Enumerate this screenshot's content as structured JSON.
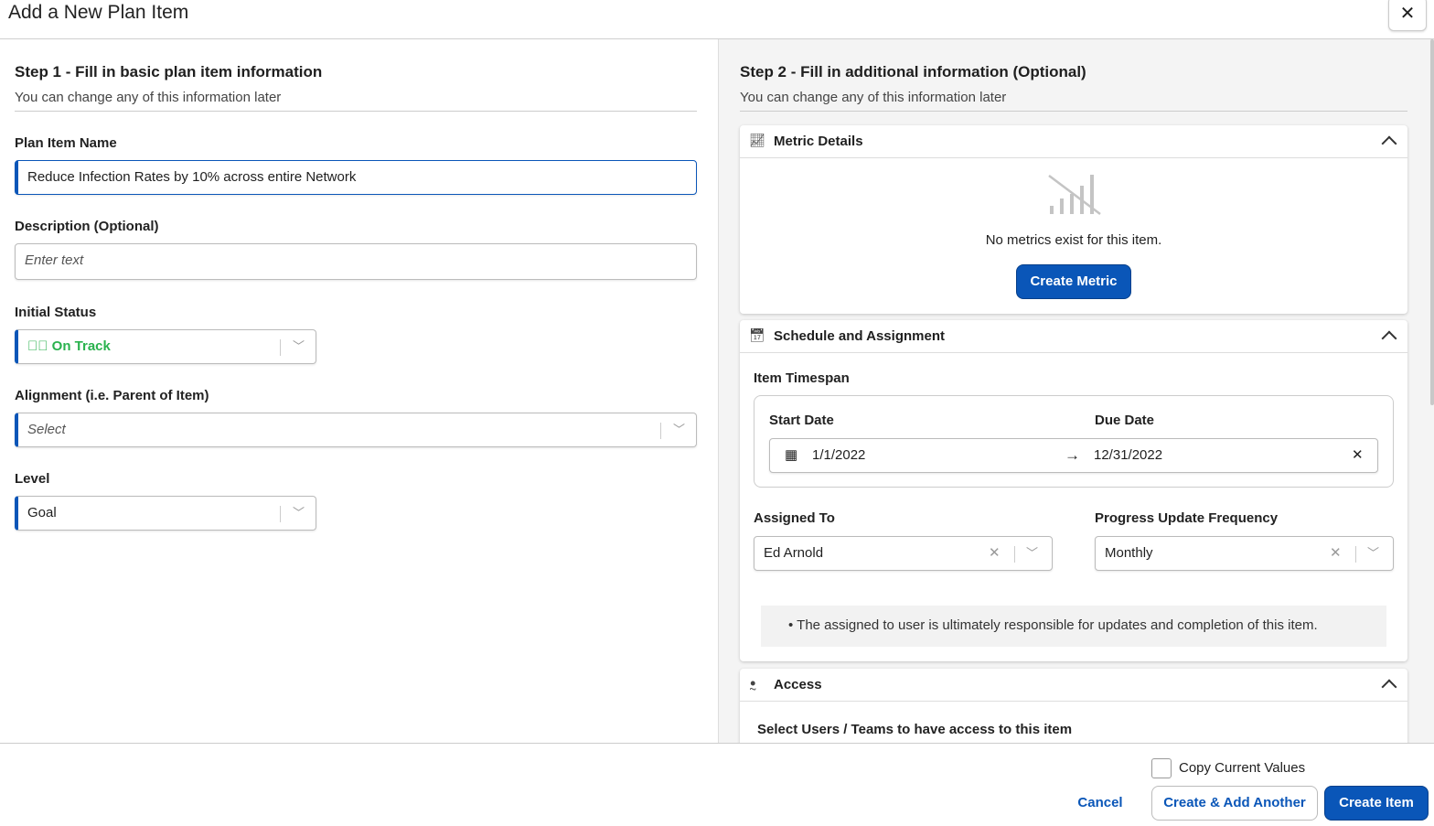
{
  "header": {
    "title": "Add a New Plan Item",
    "close": "✕"
  },
  "step1": {
    "title": "Step 1 - Fill in basic plan item information",
    "subtitle": "You can change any of this information later",
    "name_label": "Plan Item Name",
    "name_value": "Reduce Infection Rates by 10% across entire Network",
    "desc_label": "Description (Optional)",
    "desc_placeholder": "Enter text",
    "status_label": "Initial Status",
    "status_value": "On Track",
    "status_color": "#2ab24e",
    "align_label": "Alignment (i.e. Parent of Item)",
    "align_placeholder": "Select",
    "level_label": "Level",
    "level_value": "Goal"
  },
  "step2": {
    "title": "Step 2 - Fill in additional information (Optional)",
    "subtitle": "You can change any of this information later",
    "metric": {
      "title": "Metric Details",
      "empty": "No metrics exist for this item.",
      "button": "Create Metric"
    },
    "schedule": {
      "title": "Schedule and Assignment",
      "timespan_label": "Item Timespan",
      "start_label": "Start Date",
      "due_label": "Due Date",
      "start_value": "1/1/2022",
      "due_value": "12/31/2022",
      "assigned_label": "Assigned To",
      "assigned_value": "Ed Arnold",
      "freq_label": "Progress Update Frequency",
      "freq_value": "Monthly",
      "note": "The assigned to user is ultimately responsible for updates and completion of this item."
    },
    "access": {
      "title": "Access",
      "select_label": "Select Users / Teams to have access to this item"
    }
  },
  "footer": {
    "copy_label": "Copy Current Values",
    "cancel": "Cancel",
    "create_another": "Create & Add Another",
    "create": "Create Item"
  }
}
